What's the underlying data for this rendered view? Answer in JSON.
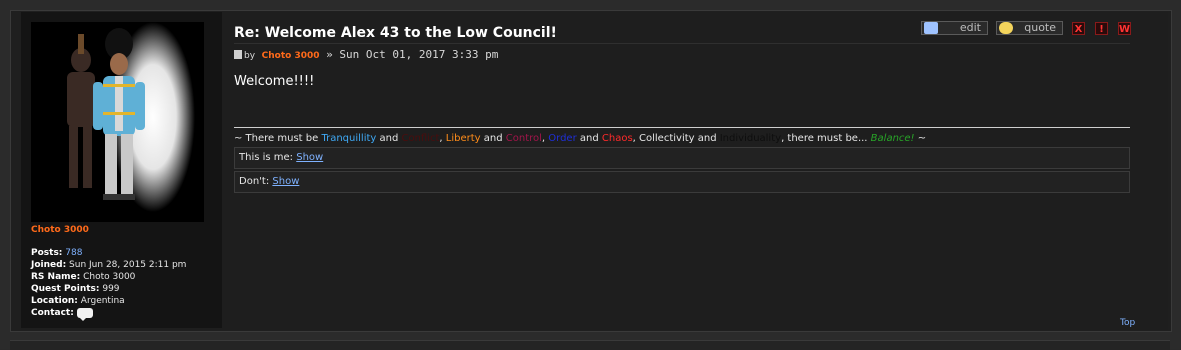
{
  "post": {
    "title": "Re: Welcome Alex 43 to the Low Council!",
    "by_label": "by",
    "author": "Choto 3000",
    "separator": "»",
    "timestamp": "Sun Oct 01, 2017 3:33 pm",
    "body": "Welcome!!!!"
  },
  "actions": {
    "edit_label": "edit",
    "quote_label": "quote",
    "delete_label": "X",
    "report_label": "!",
    "warn_label": "W"
  },
  "profile": {
    "username": "Choto 3000",
    "posts_label": "Posts:",
    "posts_value": "788",
    "joined_label": "Joined:",
    "joined_value": "Sun Jun 28, 2015 2:11 pm",
    "rsname_label": "RS Name:",
    "rsname_value": "Choto 3000",
    "qp_label": "Quest Points:",
    "qp_value": "999",
    "location_label": "Location:",
    "location_value": "Argentina",
    "contact_label": "Contact:"
  },
  "signature": {
    "parts": [
      {
        "text": "~ There must be ",
        "color": "#e6e6e6"
      },
      {
        "text": "Tranquillity",
        "color": "#3fa9f5"
      },
      {
        "text": " and ",
        "color": "#e6e6e6"
      },
      {
        "text": "Conflict",
        "color": "#4a0d0d"
      },
      {
        "text": ", ",
        "color": "#e6e6e6"
      },
      {
        "text": "Liberty",
        "color": "#ff8c1a"
      },
      {
        "text": " and ",
        "color": "#e6e6e6"
      },
      {
        "text": "Control",
        "color": "#a0154a"
      },
      {
        "text": ", ",
        "color": "#e6e6e6"
      },
      {
        "text": "Order",
        "color": "#1f2fd6"
      },
      {
        "text": " and ",
        "color": "#e6e6e6"
      },
      {
        "text": "Chaos",
        "color": "#ff2a2a"
      },
      {
        "text": ", Collectivity and ",
        "color": "#e6e6e6"
      },
      {
        "text": "Individuality",
        "color": "#0e0e0e"
      },
      {
        "text": ", there must be... ",
        "color": "#e6e6e6"
      },
      {
        "text": "Balance!",
        "color": "#28a428"
      },
      {
        "text": " ~",
        "color": "#e6e6e6"
      }
    ],
    "spoiler1_label": "This is me:",
    "spoiler1_link": "Show",
    "spoiler2_label": "Don't:",
    "spoiler2_link": "Show"
  },
  "footer": {
    "top_link": "Top"
  },
  "colors": {
    "accent_orange": "#ff6a1a",
    "link_blue": "#7fb2ff",
    "moderation_red": "#ff3333"
  }
}
